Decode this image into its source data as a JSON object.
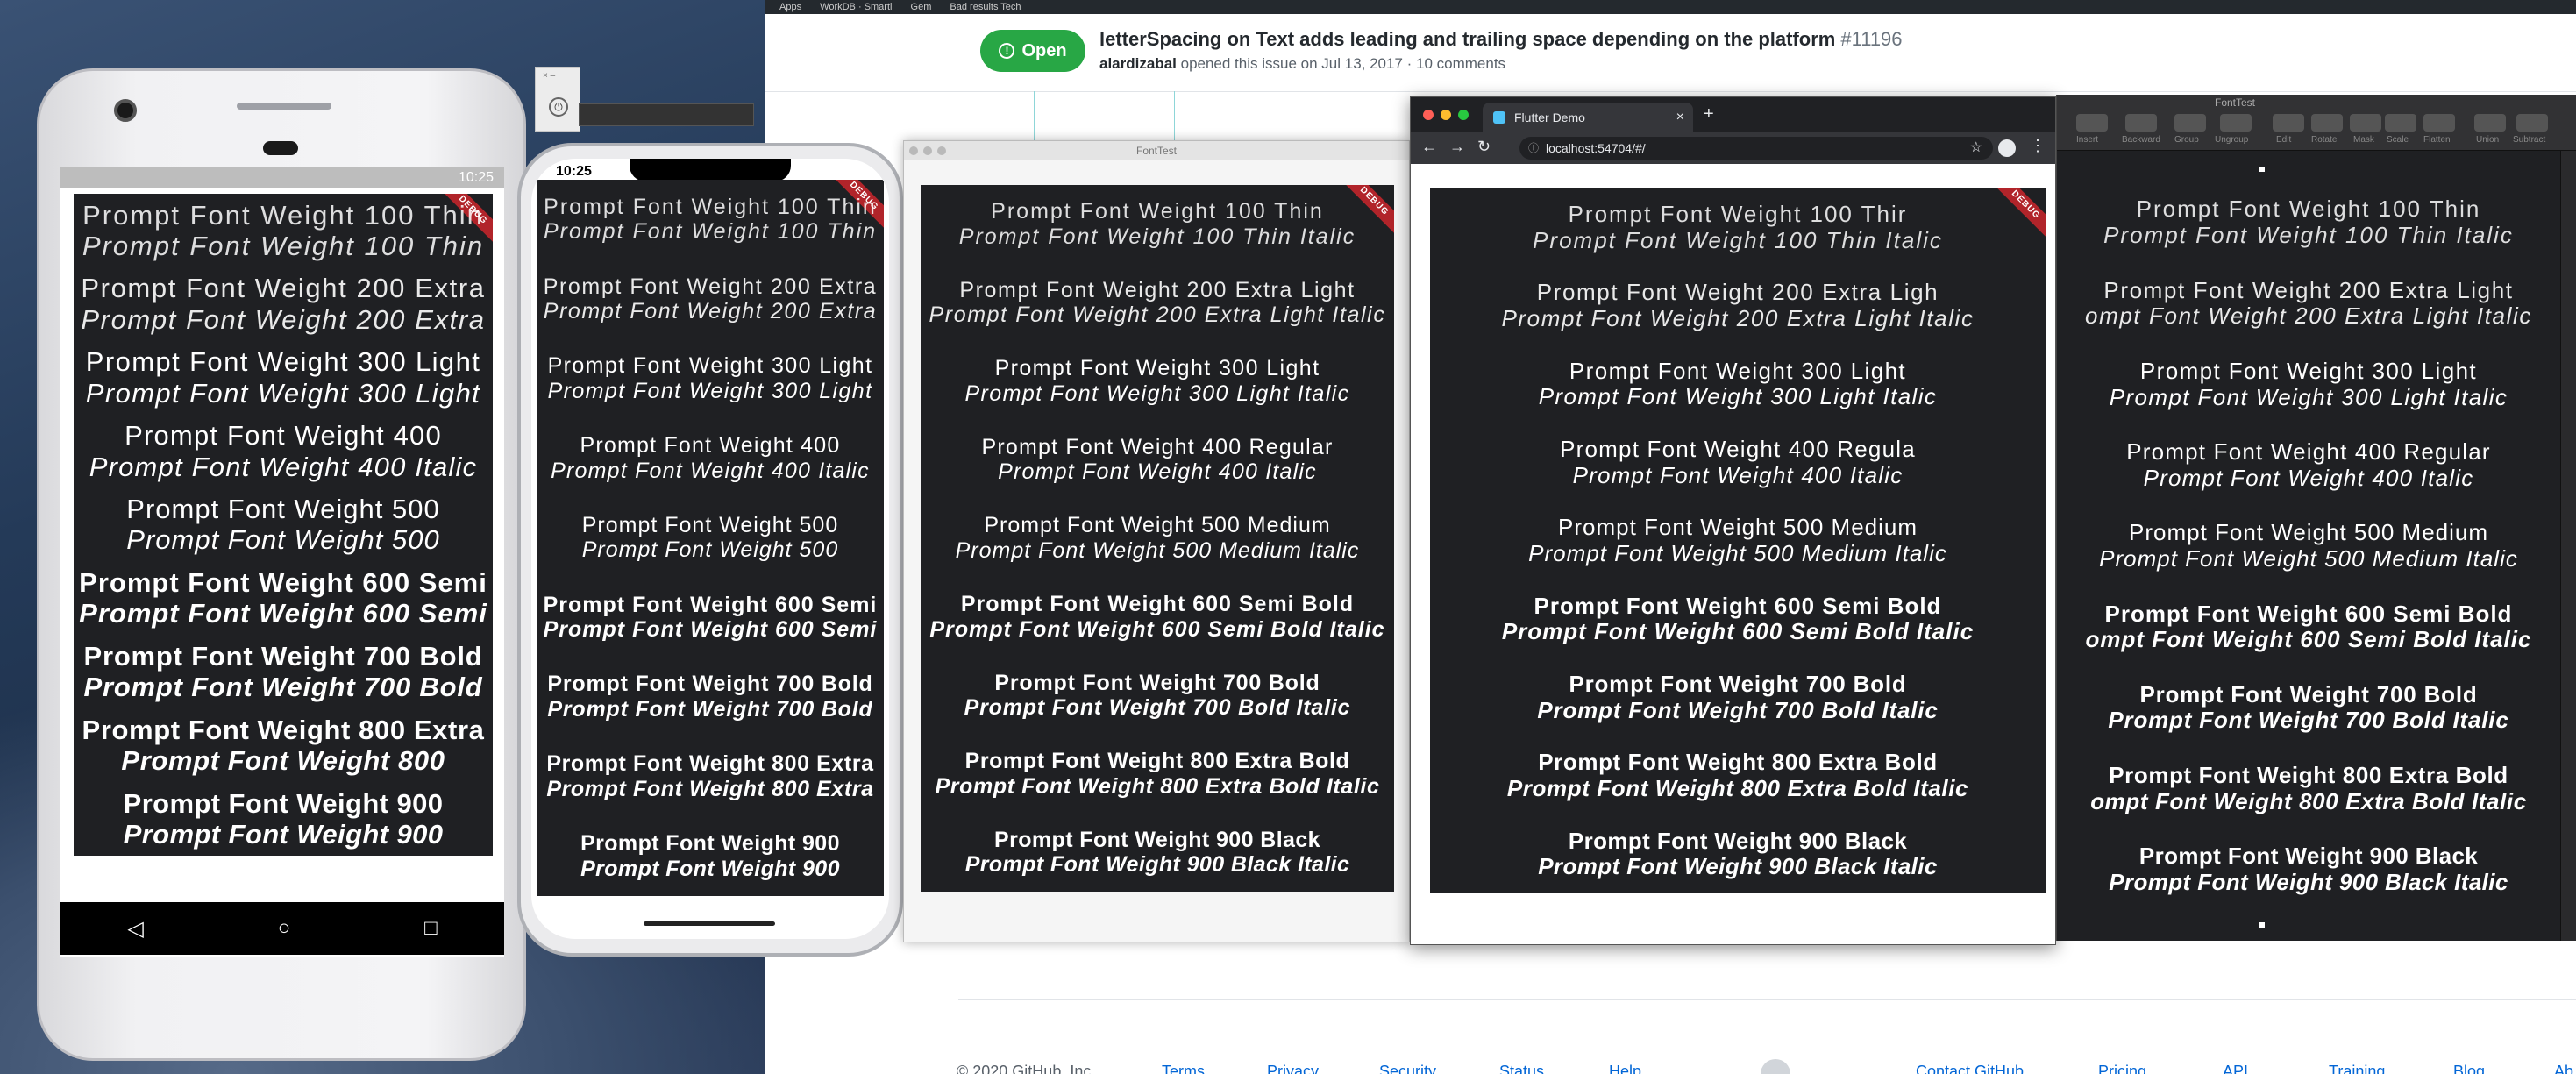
{
  "github": {
    "top_links": [
      "Apps",
      "WorkDB · Smartl",
      "Gem",
      "Bad results Tech"
    ],
    "status": "Open",
    "title": "letterSpacing on Text adds leading and trailing space depending on the platform",
    "number": "#11196",
    "author": "alardizabal",
    "meta": "opened this issue on Jul 13, 2017 · 10 comments",
    "footer": {
      "copyright": "© 2020 GitHub, Inc.",
      "links": [
        "Terms",
        "Privacy",
        "Security",
        "Status",
        "Help",
        "Contact GitHub",
        "Pricing",
        "API",
        "Training",
        "Blog",
        "Ab"
      ]
    }
  },
  "android": {
    "time": "10:25",
    "nav": {
      "back": "◁",
      "home": "○",
      "recent": "□"
    },
    "lines": [
      [
        "Prompt Font Weight 100 Thin",
        "Prompt Font Weight 100 Thin"
      ],
      [
        "Prompt Font Weight 200 Extra",
        "Prompt Font Weight 200 Extra"
      ],
      [
        "Prompt Font Weight 300 Light",
        "Prompt Font Weight 300 Light"
      ],
      [
        "Prompt Font Weight 400",
        "Prompt Font Weight 400 Italic"
      ],
      [
        "Prompt Font Weight 500",
        "Prompt Font Weight 500"
      ],
      [
        "Prompt Font Weight 600 Semi",
        "Prompt Font Weight 600 Semi"
      ],
      [
        "Prompt Font Weight 700 Bold",
        "Prompt Font Weight 700 Bold"
      ],
      [
        "Prompt Font Weight 800 Extra",
        "Prompt Font Weight 800"
      ],
      [
        "Prompt Font Weight 900",
        "Prompt Font Weight 900"
      ]
    ]
  },
  "iphone": {
    "time": "10:25",
    "lines": [
      [
        "Prompt Font Weight 100 Thin",
        "Prompt Font Weight 100 Thin"
      ],
      [
        "Prompt Font Weight 200 Extra",
        "Prompt Font Weight 200 Extra"
      ],
      [
        "Prompt Font Weight 300 Light",
        "Prompt Font Weight 300 Light"
      ],
      [
        "Prompt Font Weight 400",
        "Prompt Font Weight 400 Italic"
      ],
      [
        "Prompt Font Weight 500",
        "Prompt Font Weight 500"
      ],
      [
        "Prompt Font Weight 600 Semi",
        "Prompt Font Weight 600 Semi"
      ],
      [
        "Prompt Font Weight 700 Bold",
        "Prompt Font Weight 700 Bold"
      ],
      [
        "Prompt Font Weight 800 Extra",
        "Prompt Font Weight 800 Extra"
      ],
      [
        "Prompt Font Weight 900",
        "Prompt Font Weight 900"
      ]
    ]
  },
  "macos_app": {
    "title": "FontTest",
    "lines": [
      [
        "Prompt Font Weight 100 Thin",
        "Prompt Font Weight 100 Thin Italic"
      ],
      [
        "Prompt Font Weight 200 Extra Light",
        "Prompt Font Weight 200 Extra Light Italic"
      ],
      [
        "Prompt Font Weight 300 Light",
        "Prompt Font Weight 300 Light Italic"
      ],
      [
        "Prompt Font Weight 400 Regular",
        "Prompt Font Weight 400 Italic"
      ],
      [
        "Prompt Font Weight 500 Medium",
        "Prompt Font Weight 500 Medium Italic"
      ],
      [
        "Prompt Font Weight 600 Semi Bold",
        "Prompt Font Weight 600 Semi Bold Italic"
      ],
      [
        "Prompt Font Weight 700 Bold",
        "Prompt Font Weight 700 Bold Italic"
      ],
      [
        "Prompt Font Weight 800 Extra Bold",
        "Prompt Font Weight 800 Extra Bold Italic"
      ],
      [
        "Prompt Font Weight 900 Black",
        "Prompt Font Weight 900 Black Italic"
      ]
    ]
  },
  "browser": {
    "tab_title": "Flutter Demo",
    "url": "localhost:54704/#/",
    "lines": [
      [
        "Prompt Font Weight 100 Thir",
        "Prompt Font Weight 100 Thin Italic"
      ],
      [
        "Prompt Font Weight 200 Extra Ligh",
        "Prompt Font Weight 200 Extra Light Italic"
      ],
      [
        "Prompt Font Weight 300 Light",
        "Prompt Font Weight 300 Light Italic"
      ],
      [
        "Prompt Font Weight 400 Regula",
        "Prompt Font Weight 400 Italic"
      ],
      [
        "Prompt Font Weight 500 Medium",
        "Prompt Font Weight 500 Medium Italic"
      ],
      [
        "Prompt Font Weight 600 Semi Bold",
        "Prompt Font Weight 600 Semi Bold Italic"
      ],
      [
        "Prompt Font Weight 700 Bold",
        "Prompt Font Weight 700 Bold Italic"
      ],
      [
        "Prompt Font Weight 800 Extra Bold",
        "Prompt Font Weight 800 Extra Bold Italic"
      ],
      [
        "Prompt Font Weight 900 Black",
        "Prompt Font Weight 900 Black Italic"
      ]
    ]
  },
  "sketch_app": {
    "title": "FontTest",
    "toolbar": [
      "Insert",
      "Backward",
      "Group",
      "Ungroup",
      "Edit",
      "Rotate",
      "Mask",
      "Scale",
      "Flatten",
      "Union",
      "Subtract"
    ],
    "lines": [
      [
        "Prompt Font Weight 100 Thin",
        "Prompt Font Weight 100 Thin Italic"
      ],
      [
        "Prompt Font Weight 200 Extra Light",
        "ompt Font Weight 200 Extra Light Italic"
      ],
      [
        "Prompt Font Weight 300 Light",
        "Prompt Font Weight 300 Light Italic"
      ],
      [
        "Prompt Font Weight 400 Regular",
        "Prompt Font Weight 400 Italic"
      ],
      [
        "Prompt Font Weight 500 Medium",
        "Prompt Font Weight 500 Medium Italic"
      ],
      [
        "Prompt Font Weight 600 Semi Bold",
        "ompt Font Weight 600 Semi Bold Italic"
      ],
      [
        "Prompt Font Weight 700 Bold",
        "Prompt Font Weight 700 Bold Italic"
      ],
      [
        "Prompt Font Weight 800 Extra Bold",
        "ompt Font Weight 800 Extra Bold Italic"
      ],
      [
        "Prompt Font Weight 900 Black",
        "Prompt Font Weight 900 Black Italic"
      ]
    ]
  },
  "debug_banner": "DEBUG",
  "colors": {
    "open_green": "#28a745",
    "app_bg": "#1f2023",
    "debug_red": "#b1242a",
    "link_blue": "#0366d6"
  }
}
